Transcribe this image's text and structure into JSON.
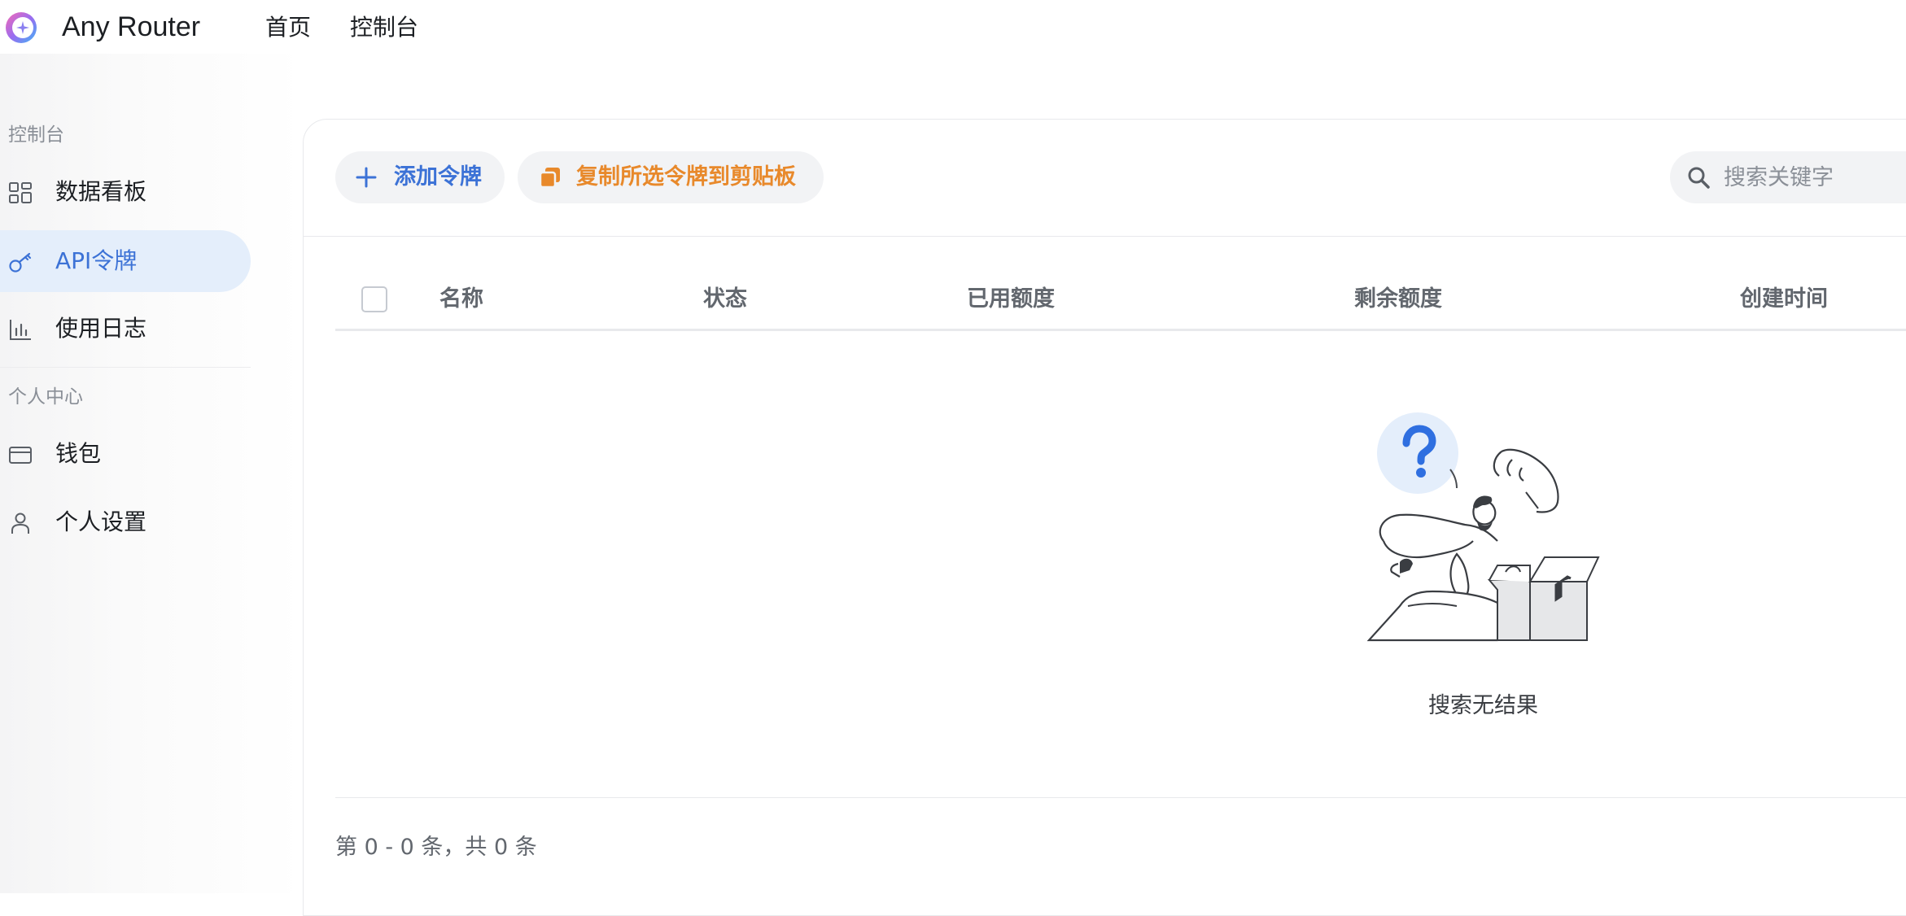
{
  "header": {
    "app_title": "Any Router",
    "nav": [
      "首页",
      "控制台"
    ]
  },
  "sidebar": {
    "groups": [
      {
        "label": "控制台",
        "items": [
          {
            "label": "数据看板",
            "icon": "dashboard-icon"
          },
          {
            "label": "API令牌",
            "icon": "key-icon",
            "active": true
          },
          {
            "label": "使用日志",
            "icon": "bar-chart-icon"
          }
        ]
      },
      {
        "label": "个人中心",
        "items": [
          {
            "label": "钱包",
            "icon": "wallet-icon"
          },
          {
            "label": "个人设置",
            "icon": "user-icon"
          }
        ]
      }
    ]
  },
  "toolbar": {
    "add_token_label": "添加令牌",
    "copy_selected_label": "复制所选令牌到剪贴板",
    "search_placeholder": "搜索关键字"
  },
  "table": {
    "columns": [
      "名称",
      "状态",
      "已用额度",
      "剩余额度",
      "创建时间"
    ],
    "rows": [],
    "empty_text": "搜索无结果"
  },
  "pagination": {
    "info": "第 0 - 0 条，共 0 条"
  },
  "colors": {
    "accent": "#3c72d6",
    "active_bg": "#e4eefb",
    "copy_button_text": "#e8892b"
  }
}
